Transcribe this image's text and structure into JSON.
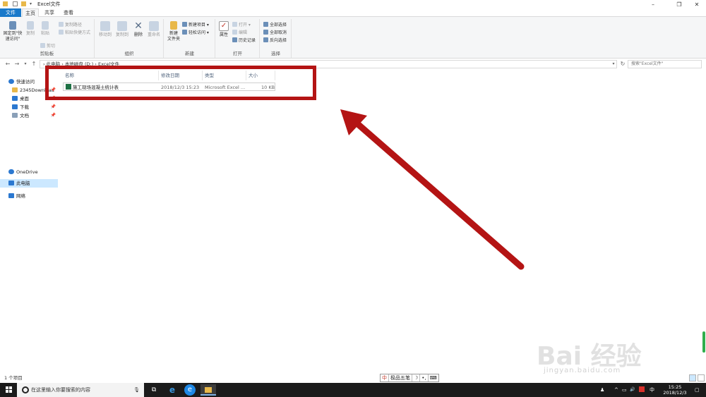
{
  "window": {
    "title": "Excel文件",
    "controls": {
      "minimize": "–",
      "restore": "❐",
      "close": "✕"
    }
  },
  "ribbon_tabs": {
    "file": "文件",
    "home": "主页",
    "share": "共享",
    "view": "查看"
  },
  "ribbon": {
    "clipboard": {
      "label": "剪贴板",
      "pin": "固定到\"快速访问\"",
      "copy": "复制",
      "paste": "粘贴",
      "copy_path": "复制路径",
      "paste_shortcut": "粘贴快捷方式",
      "cut": "剪切"
    },
    "organize": {
      "label": "组织",
      "move_to": "移动到",
      "copy_to": "复制到",
      "delete": "删除",
      "rename": "重命名"
    },
    "new": {
      "label": "新建",
      "new_folder": "新建\n文件夹",
      "new_item": "新建项目 ▾",
      "easy_access": "轻松访问 ▾"
    },
    "open": {
      "label": "打开",
      "properties": "属性",
      "open": "打开 ▾",
      "edit": "编辑",
      "history": "历史记录"
    },
    "select": {
      "label": "选择",
      "select_all": "全部选择",
      "select_none": "全部取消",
      "invert": "反向选择"
    }
  },
  "address": {
    "back": "←",
    "forward": "→",
    "recent": "▾",
    "up": "↑",
    "path": "› 此电脑 › 本地磁盘 (D:) › Excel文件",
    "dropdown": "▾",
    "refresh": "↻",
    "search_placeholder": "搜索\"Excel文件\""
  },
  "nav_pane": {
    "quick_access": "快速访问",
    "items": [
      {
        "label": "2345Download",
        "pin": "📌"
      },
      {
        "label": "桌面",
        "pin": "📌"
      },
      {
        "label": "下载",
        "pin": "📌"
      },
      {
        "label": "文档",
        "pin": "📌"
      }
    ],
    "onedrive": "OneDrive",
    "this_pc": "此电脑",
    "network": "网络"
  },
  "file_list": {
    "sort_indicator": "^",
    "columns": {
      "name": "名称",
      "modified": "修改日期",
      "type": "类型",
      "size": "大小"
    },
    "rows": [
      {
        "name": "施工现场混凝土统计表",
        "modified": "2018/12/3 15:23",
        "type": "Microsoft Excel ...",
        "size": "10 KB"
      }
    ]
  },
  "status": {
    "count": "1 个项目"
  },
  "ime": {
    "logo": "中",
    "mode": "极品五笔",
    "moon": "☽",
    "punct": "•,",
    "kbd": "⌨"
  },
  "taskbar": {
    "search_placeholder": "在这里输入你要搜索的内容",
    "time": "15:25",
    "date": "2018/12/3",
    "lang": "中",
    "volume": "🔊"
  },
  "watermark": {
    "brand": "Bai 经验",
    "url": "jingyan.baidu.com"
  },
  "colors": {
    "annotation_red": "#b41414",
    "file_tab_blue": "#1979ca",
    "selection": "#cce8ff"
  }
}
